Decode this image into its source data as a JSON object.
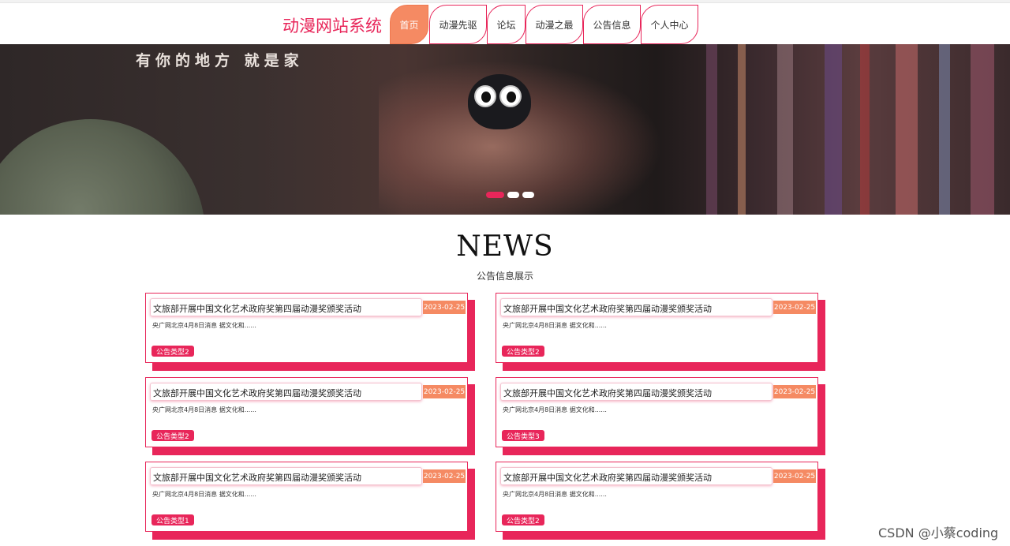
{
  "header": {
    "site_title": "动漫网站系统",
    "nav": [
      {
        "label": "首页",
        "active": true
      },
      {
        "label": "动漫先驱",
        "active": false
      },
      {
        "label": "论坛",
        "active": false
      },
      {
        "label": "动漫之最",
        "active": false
      },
      {
        "label": "公告信息",
        "active": false
      },
      {
        "label": "个人中心",
        "active": false
      }
    ]
  },
  "banner": {
    "slogan": "有你的地方  就是家",
    "slide_count": 3,
    "active_slide": 1
  },
  "news": {
    "title": "NEWS",
    "subtitle": "公告信息展示",
    "items": [
      {
        "title": "文旅部开展中国文化艺术政府奖第四届动漫奖颁奖活动",
        "date": "2023-02-25",
        "summary": "央广网北京4月8日消息 据文化和......",
        "tag": "公告类型2"
      },
      {
        "title": "文旅部开展中国文化艺术政府奖第四届动漫奖颁奖活动",
        "date": "2023-02-25",
        "summary": "央广网北京4月8日消息 据文化和......",
        "tag": "公告类型2"
      },
      {
        "title": "文旅部开展中国文化艺术政府奖第四届动漫奖颁奖活动",
        "date": "2023-02-25",
        "summary": "央广网北京4月8日消息 据文化和......",
        "tag": "公告类型2"
      },
      {
        "title": "文旅部开展中国文化艺术政府奖第四届动漫奖颁奖活动",
        "date": "2023-02-25",
        "summary": "央广网北京4月8日消息 据文化和......",
        "tag": "公告类型3"
      },
      {
        "title": "文旅部开展中国文化艺术政府奖第四届动漫奖颁奖活动",
        "date": "2023-02-25",
        "summary": "央广网北京4月8日消息 据文化和......",
        "tag": "公告类型1"
      },
      {
        "title": "文旅部开展中国文化艺术政府奖第四届动漫奖颁奖活动",
        "date": "2023-02-25",
        "summary": "央广网北京4月8日消息 据文化和......",
        "tag": "公告类型2"
      }
    ]
  },
  "watermark": "CSDN @小蔡coding",
  "colors": {
    "accent": "#e8265a",
    "date_badge": "#f58a63",
    "nav_active": "#f58a63"
  }
}
